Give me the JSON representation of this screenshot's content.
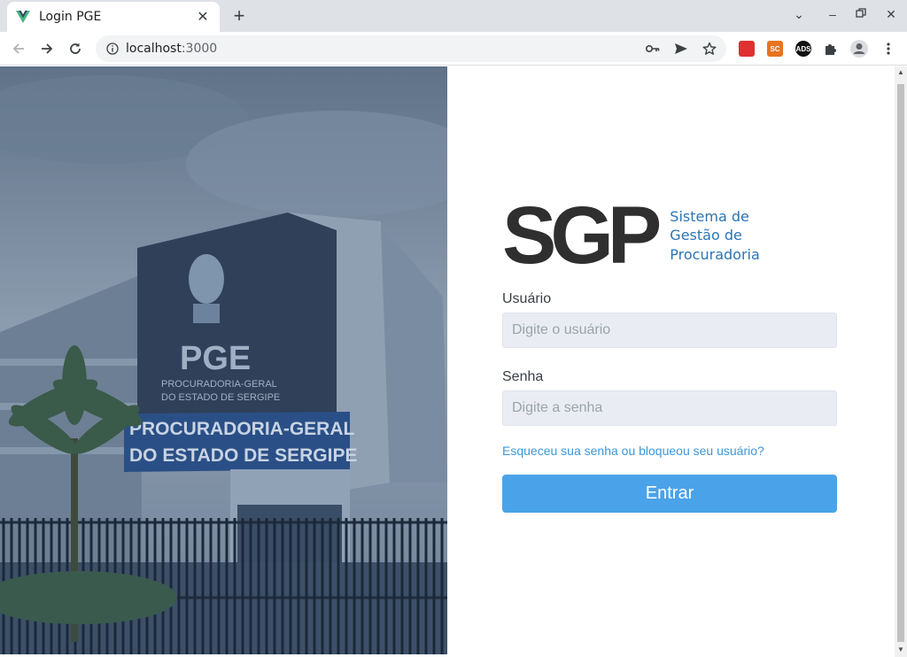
{
  "browser": {
    "tab_title": "Login PGE",
    "url_host": "localhost",
    "url_port": ":3000",
    "extensions": [
      {
        "name": "ext-red",
        "label": "",
        "color": "#e03030"
      },
      {
        "name": "ext-sc",
        "label": "SC",
        "color": "#e8731f"
      },
      {
        "name": "ext-ads",
        "label": "ADS",
        "color": "#111111"
      }
    ]
  },
  "hero": {
    "sign_line1": "PROCURADORIA-GERAL",
    "sign_line2": "DO ESTADO DE SERGIPE",
    "building_brand": "PGE",
    "building_sub1": "PROCURADORIA-GERAL",
    "building_sub2": "DO ESTADO DE SERGIPE"
  },
  "login": {
    "logo_text": "SGP",
    "logo_sub": [
      "Sistema de",
      "Gestão de",
      "Procuradoria"
    ],
    "user_label": "Usuário",
    "user_placeholder": "Digite o usuário",
    "password_label": "Senha",
    "password_placeholder": "Digite a senha",
    "forgot_link": "Esqueceu sua senha ou bloqueou seu usuário?",
    "submit_label": "Entrar"
  },
  "colors": {
    "accent": "#4aa3e8",
    "link": "#3d97d8",
    "logo_blue": "#2c74b3"
  }
}
